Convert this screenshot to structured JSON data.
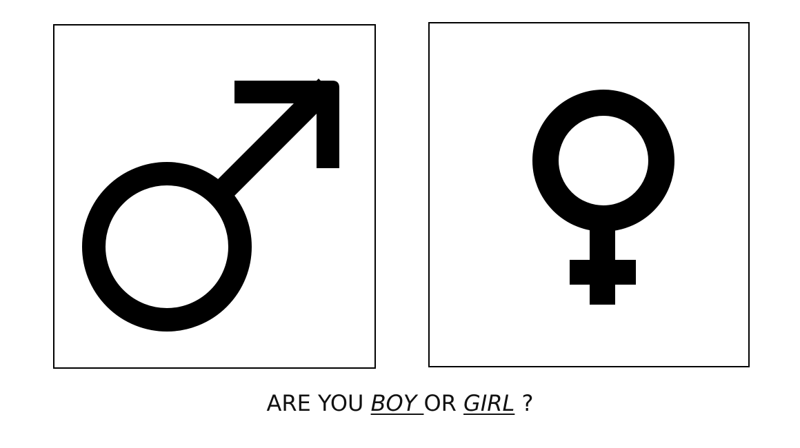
{
  "question": {
    "prefix": "ARE YOU ",
    "option_boy": "BOY ",
    "connector": "OR ",
    "option_girl": "GIRL",
    "suffix": " ?"
  },
  "symbols": {
    "left": "male-symbol-icon",
    "right": "female-symbol-icon"
  },
  "colors": {
    "ink": "#000000",
    "background": "#ffffff"
  }
}
